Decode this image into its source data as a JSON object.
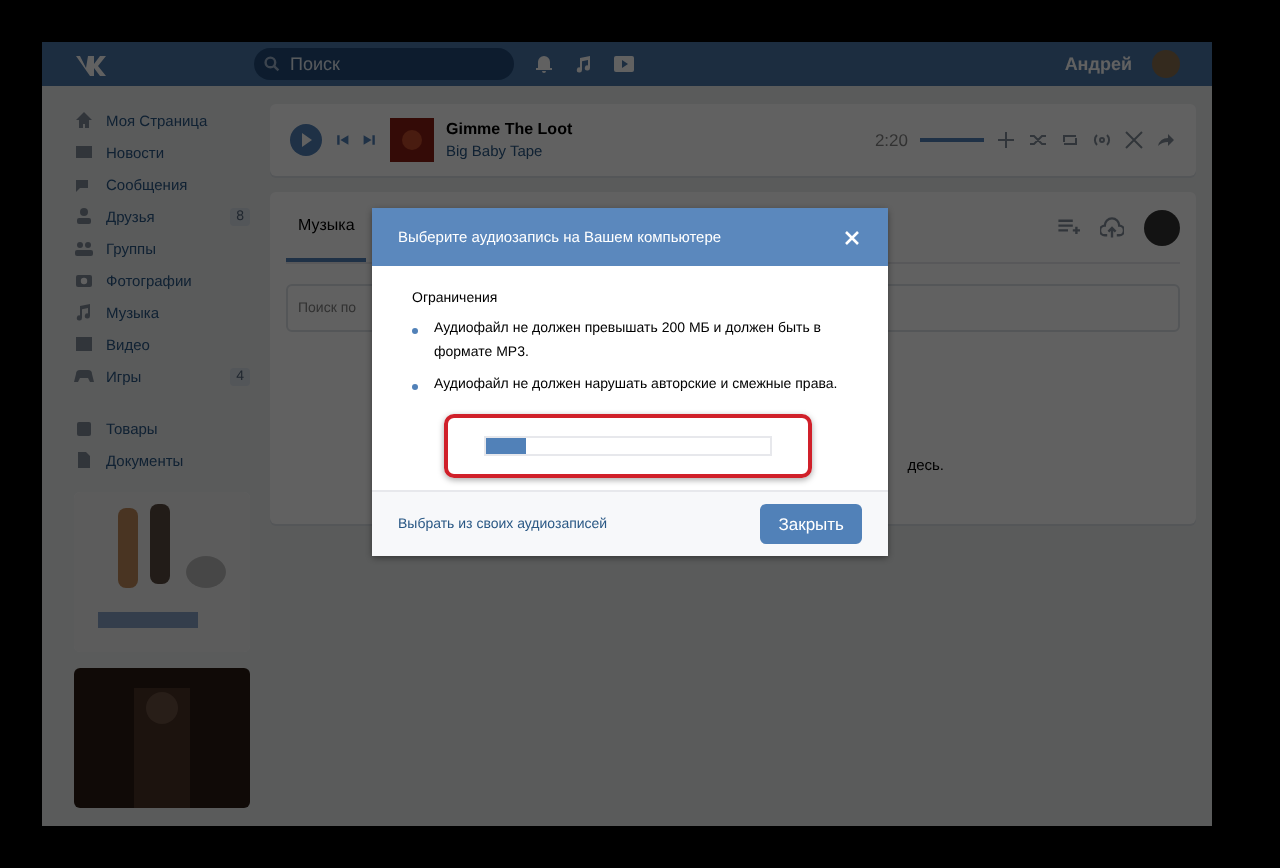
{
  "header": {
    "search_placeholder": "Поиск",
    "user_name": "Андрей"
  },
  "sidebar": {
    "items": [
      {
        "label": "Моя Страница"
      },
      {
        "label": "Новости"
      },
      {
        "label": "Сообщения"
      },
      {
        "label": "Друзья",
        "count": "8"
      },
      {
        "label": "Группы"
      },
      {
        "label": "Фотографии"
      },
      {
        "label": "Музыка"
      },
      {
        "label": "Видео"
      },
      {
        "label": "Игры",
        "count": "4"
      }
    ],
    "extra_items": [
      {
        "label": "Товары"
      },
      {
        "label": "Документы"
      }
    ]
  },
  "player": {
    "title": "Gimme The Loot",
    "artist": "Big Baby Tape",
    "time": "2:20",
    "volume": {
      "level": 1
    }
  },
  "music": {
    "tabs": [
      {
        "label": "Музыка",
        "selected": true
      }
    ],
    "search_placeholder": "Поиск по",
    "note": "десь."
  },
  "dialog": {
    "title": "Выберите аудиозапись на Вашем компьютере",
    "section": "Ограничения",
    "rules": [
      "Аудиофайл не должен превышать 200 МБ и должен быть в формате MP3.",
      "Аудиофайл не должен нарушать авторские и смежные права."
    ],
    "upload": {
      "level": 0.14,
      "highlighted": true
    },
    "link": "Выбрать из своих аудиозаписей",
    "button": "Закрыть"
  }
}
